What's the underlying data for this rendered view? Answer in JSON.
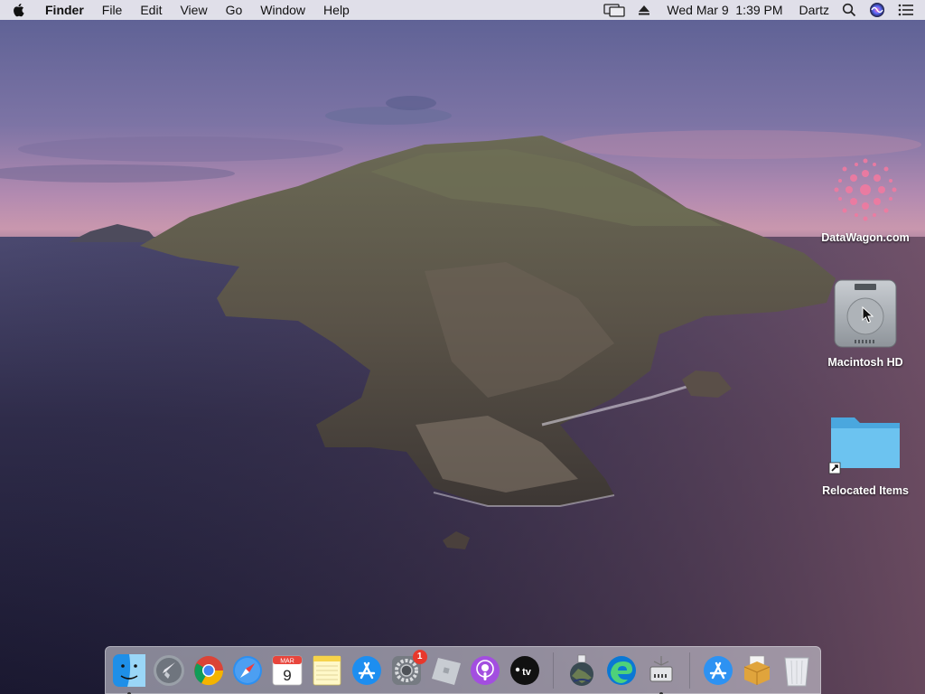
{
  "menubar": {
    "apple_icon": "apple-logo-icon",
    "app_name": "Finder",
    "menus": [
      "File",
      "Edit",
      "View",
      "Go",
      "Window",
      "Help"
    ],
    "status_icons": [
      "display-mirroring-icon",
      "eject-icon"
    ],
    "clock": "Wed Mar 9  1:39 PM",
    "user": "Dartz",
    "spotlight_icon": "search-icon",
    "siri_icon": "siri-icon",
    "notification_icon": "notification-center-icon"
  },
  "desktop": {
    "icons": [
      {
        "label": "DataWagon.com",
        "icon": "datawagon-logo-icon"
      },
      {
        "label": "Macintosh HD",
        "icon": "hard-drive-icon"
      },
      {
        "label": "Relocated Items",
        "icon": "folder-alias-icon"
      }
    ]
  },
  "dock": {
    "items": [
      {
        "name": "Finder",
        "icon": "finder-icon",
        "running": true
      },
      {
        "name": "Launchpad",
        "icon": "launchpad-icon"
      },
      {
        "name": "Google Chrome",
        "icon": "chrome-icon"
      },
      {
        "name": "Safari",
        "icon": "safari-icon"
      },
      {
        "name": "Calendar",
        "icon": "calendar-icon",
        "month": "MAR",
        "day": "9"
      },
      {
        "name": "Notes",
        "icon": "notes-icon"
      },
      {
        "name": "App Store",
        "icon": "app-store-icon"
      },
      {
        "name": "System Preferences",
        "icon": "system-preferences-icon",
        "badge": "1"
      },
      {
        "name": "Roblox",
        "icon": "roblox-icon"
      },
      {
        "name": "Podcasts",
        "icon": "podcasts-icon"
      },
      {
        "name": "TV",
        "icon": "apple-tv-icon",
        "text": "tv"
      },
      {
        "name": "Catalina Installer",
        "icon": "macos-installer-icon"
      },
      {
        "name": "Microsoft Edge",
        "icon": "edge-icon"
      },
      {
        "name": "Network Utility",
        "icon": "network-utility-icon",
        "running": true
      },
      {
        "name": "App Store Downloads",
        "icon": "app-store-folder-icon"
      },
      {
        "name": "Archive Utility",
        "icon": "package-icon"
      },
      {
        "name": "Trash",
        "icon": "trash-icon"
      }
    ]
  },
  "colors": {
    "menubar_bg": "#ECEAF0",
    "badge": "#E8382C",
    "folder": "#5BB8EC"
  }
}
